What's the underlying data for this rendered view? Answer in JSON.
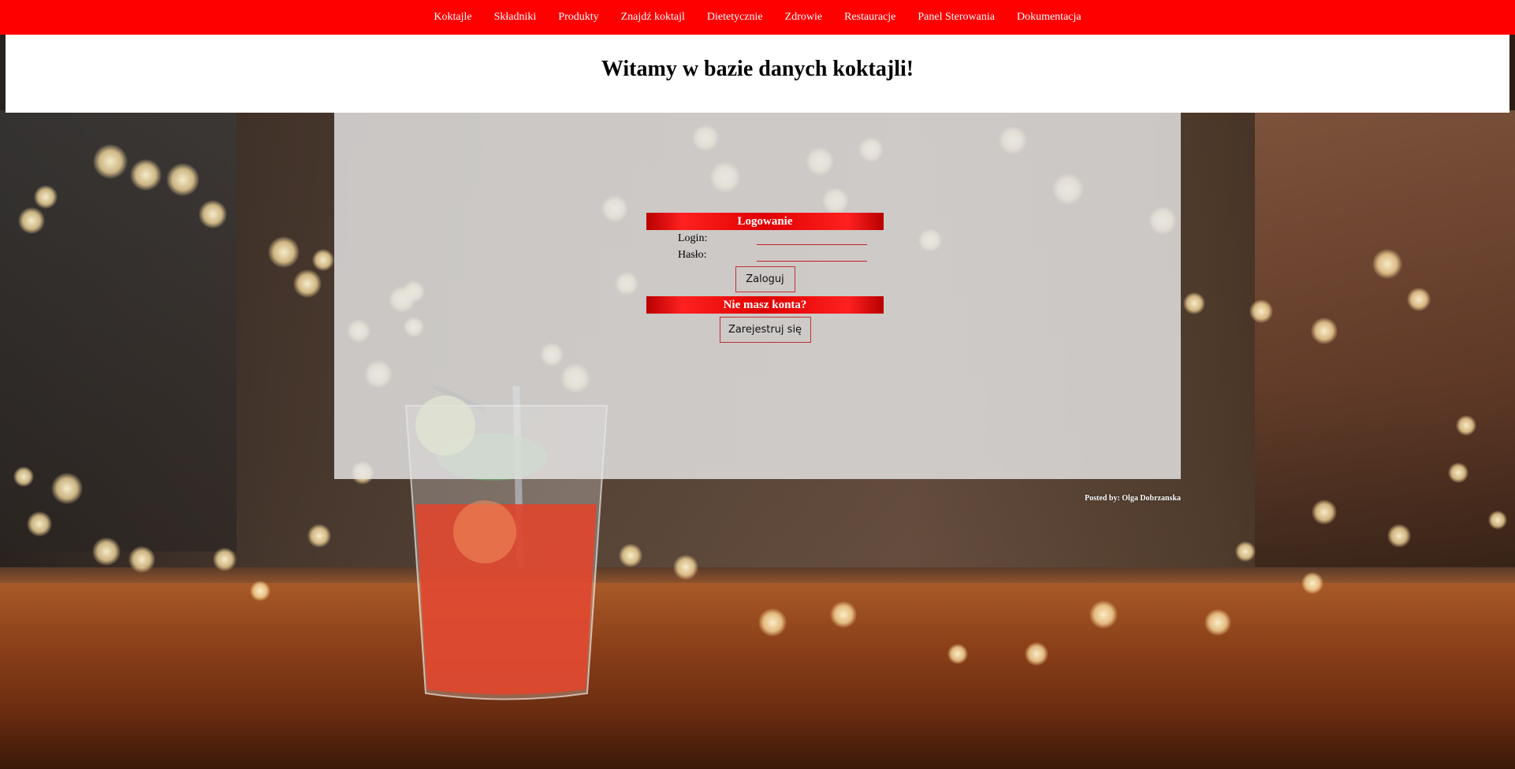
{
  "nav": {
    "items": [
      {
        "label": "Koktajle"
      },
      {
        "label": "Składniki"
      },
      {
        "label": "Produkty"
      },
      {
        "label": "Znajdź koktajl"
      },
      {
        "label": "Dietetycznie"
      },
      {
        "label": "Zdrowie"
      },
      {
        "label": "Restauracje"
      },
      {
        "label": "Panel Sterowania"
      },
      {
        "label": "Dokumentacja"
      }
    ]
  },
  "header": {
    "title": "Witamy w bazie danych koktajli!"
  },
  "login": {
    "heading": "Logowanie",
    "login_label": "Login:",
    "password_label": "Hasło:",
    "login_value": "",
    "password_value": "",
    "submit_label": "Zaloguj"
  },
  "register": {
    "heading": "Nie masz konta?",
    "button_label": "Zarejestruj się"
  },
  "footer": {
    "posted_by": "Posted by: Olga Dobrzanska"
  },
  "colors": {
    "accent": "#ff0000",
    "header_bg": "#ffffff",
    "panel_bg": "#e6e6e6"
  }
}
